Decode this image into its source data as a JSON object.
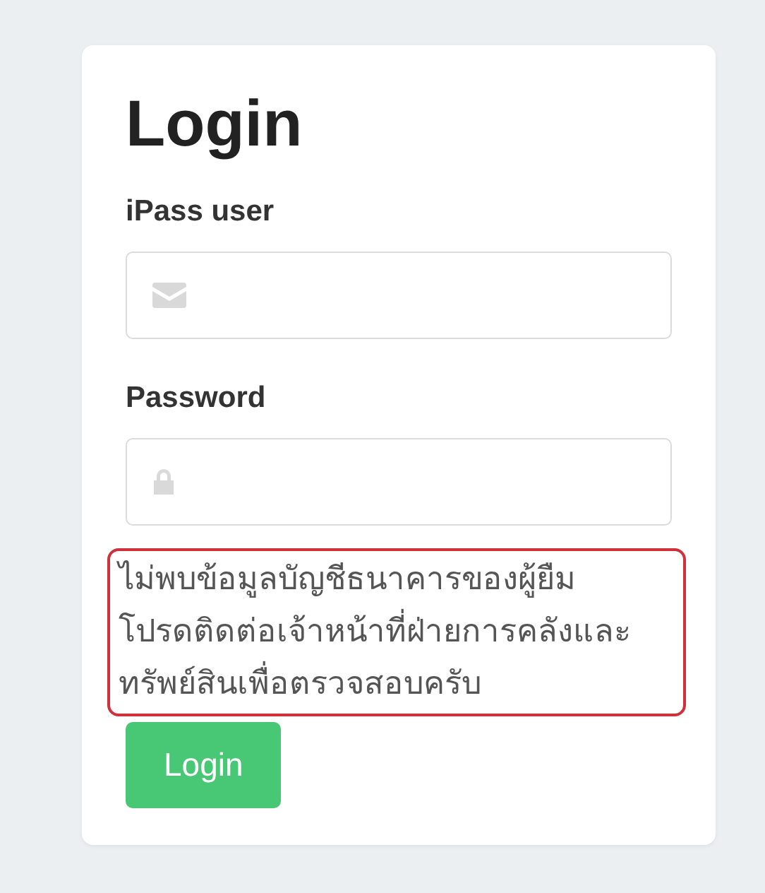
{
  "title": "Login",
  "fields": [
    {
      "label": "iPass user",
      "kind": "email"
    },
    {
      "label": "Password",
      "kind": "password"
    }
  ],
  "error": {
    "lines": [
      "ไม่พบข้อมูลบัญชีธนาคารของผู้ยืม",
      "โปรดติดต่อเจ้าหน้าที่ฝ่ายการคลังและ",
      "ทรัพย์สินเพื่อตรวจสอบครับ"
    ]
  },
  "button": "Login"
}
